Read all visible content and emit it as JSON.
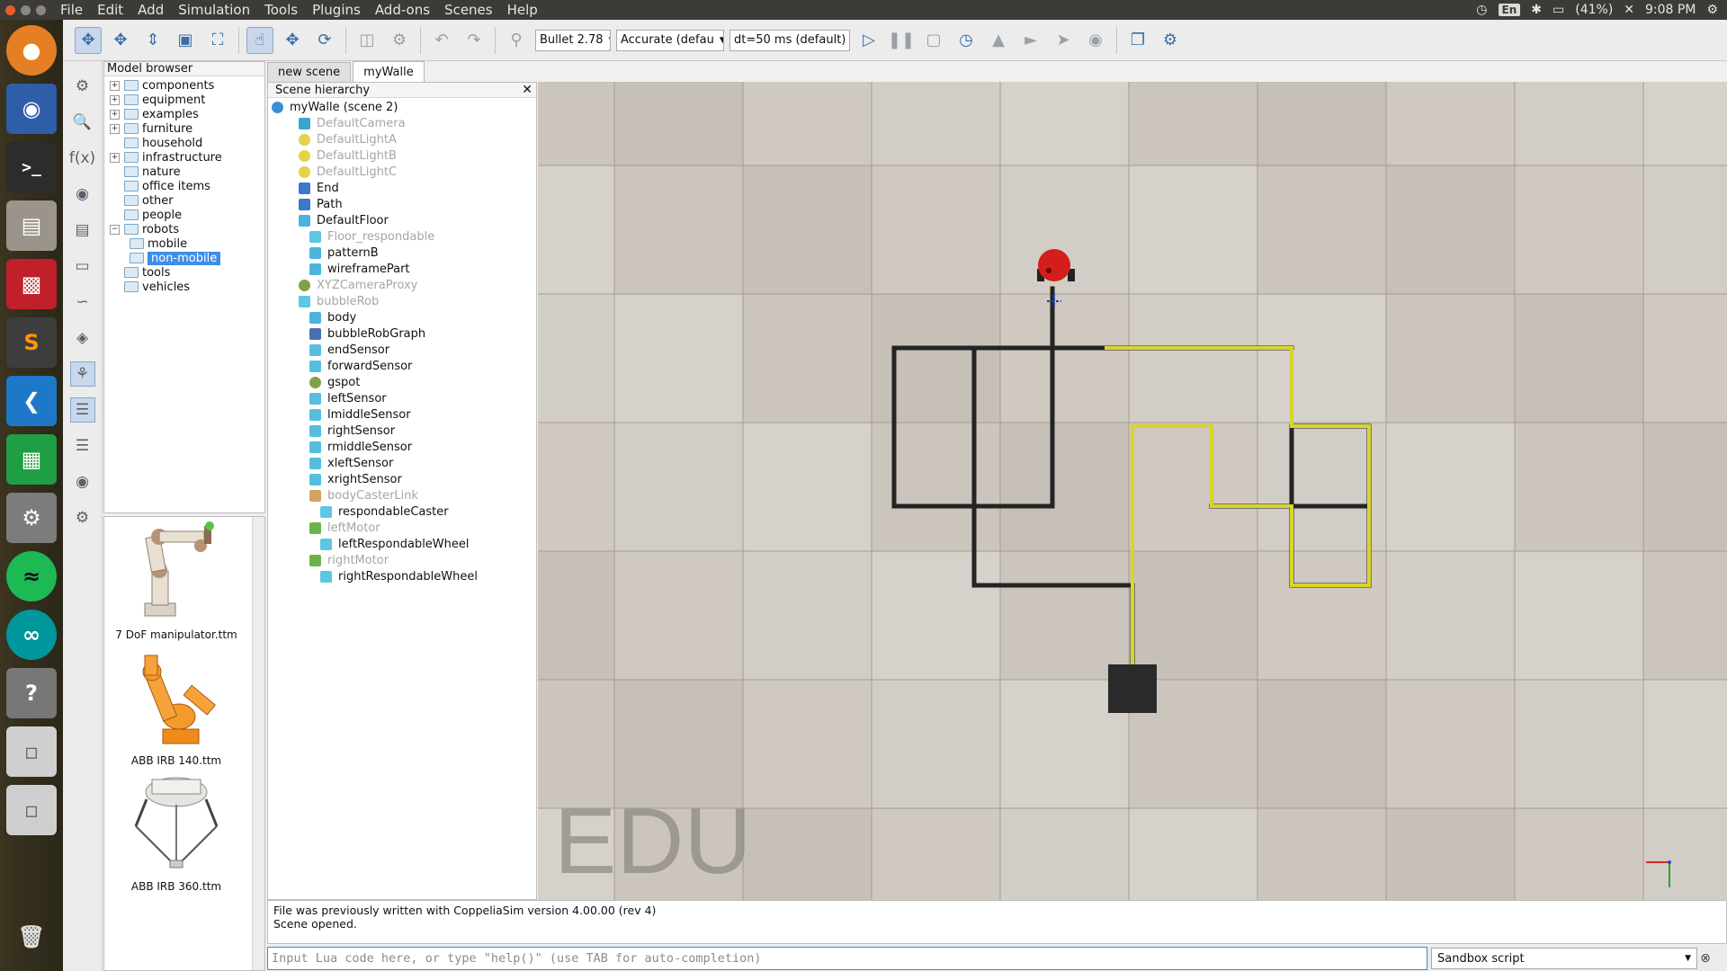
{
  "menubar": {
    "items": [
      "File",
      "Edit",
      "Add",
      "Simulation",
      "Tools",
      "Plugins",
      "Add-ons",
      "Scenes",
      "Help"
    ]
  },
  "system": {
    "language": "En",
    "battery": "(41%)",
    "time": "9:08 PM"
  },
  "toolbar": {
    "engine": "Bullet 2.78",
    "accuracy": "Accurate (defau",
    "timestep": "dt=50 ms (default)"
  },
  "model_browser": {
    "title": "Model browser",
    "items": [
      {
        "label": "components",
        "expandable": true
      },
      {
        "label": "equipment",
        "expandable": true
      },
      {
        "label": "examples",
        "expandable": true
      },
      {
        "label": "furniture",
        "expandable": true
      },
      {
        "label": "household",
        "expandable": false
      },
      {
        "label": "infrastructure",
        "expandable": true
      },
      {
        "label": "nature",
        "expandable": false
      },
      {
        "label": "office items",
        "expandable": false
      },
      {
        "label": "other",
        "expandable": false
      },
      {
        "label": "people",
        "expandable": false
      },
      {
        "label": "robots",
        "expandable": true,
        "expanded": true
      },
      {
        "label": "mobile",
        "child": true
      },
      {
        "label": "non-mobile",
        "child": true,
        "selected": true
      },
      {
        "label": "tools",
        "expandable": false
      },
      {
        "label": "vehicles",
        "expandable": false
      }
    ],
    "thumbnails": [
      "7 DoF manipulator.ttm",
      "ABB IRB 140.ttm",
      "ABB IRB 360.ttm"
    ]
  },
  "tabs": [
    "new scene",
    "myWalle"
  ],
  "scene_hierarchy": {
    "title": "Scene hierarchy",
    "rows": [
      {
        "label": "myWalle (scene 2)",
        "level": 0,
        "icon": "scene",
        "gray": false
      },
      {
        "label": "DefaultCamera",
        "level": 1,
        "icon": "camera",
        "gray": true
      },
      {
        "label": "DefaultLightA",
        "level": 1,
        "icon": "light",
        "gray": true
      },
      {
        "label": "DefaultLightB",
        "level": 1,
        "icon": "light",
        "gray": true
      },
      {
        "label": "DefaultLightC",
        "level": 1,
        "icon": "light",
        "gray": true
      },
      {
        "label": "End",
        "level": 1,
        "icon": "path",
        "gray": false
      },
      {
        "label": "Path",
        "level": 1,
        "icon": "path",
        "gray": false
      },
      {
        "label": "DefaultFloor",
        "level": 1,
        "icon": "shape",
        "gray": false
      },
      {
        "label": "Floor_respondable",
        "level": 2,
        "icon": "cuboid",
        "gray": true
      },
      {
        "label": "patternB",
        "level": 2,
        "icon": "shape",
        "gray": false
      },
      {
        "label": "wireframePart",
        "level": 2,
        "icon": "shape",
        "gray": false
      },
      {
        "label": "XYZCameraProxy",
        "level": 1,
        "icon": "proxy",
        "gray": true
      },
      {
        "label": "bubbleRob",
        "level": 1,
        "icon": "cuboid",
        "gray": true
      },
      {
        "label": "body",
        "level": 2,
        "icon": "shape",
        "gray": false
      },
      {
        "label": "bubbleRobGraph",
        "level": 2,
        "icon": "graph",
        "gray": false
      },
      {
        "label": "endSensor",
        "level": 2,
        "icon": "sensor",
        "gray": false
      },
      {
        "label": "forwardSensor",
        "level": 2,
        "icon": "sensor",
        "gray": false
      },
      {
        "label": "gspot",
        "level": 2,
        "icon": "proxy",
        "gray": false
      },
      {
        "label": "leftSensor",
        "level": 2,
        "icon": "sensor",
        "gray": false
      },
      {
        "label": "lmiddleSensor",
        "level": 2,
        "icon": "sensor",
        "gray": false
      },
      {
        "label": "rightSensor",
        "level": 2,
        "icon": "sensor",
        "gray": false
      },
      {
        "label": "rmiddleSensor",
        "level": 2,
        "icon": "sensor",
        "gray": false
      },
      {
        "label": "xleftSensor",
        "level": 2,
        "icon": "sensor",
        "gray": false
      },
      {
        "label": "xrightSensor",
        "level": 2,
        "icon": "sensor",
        "gray": false
      },
      {
        "label": "bodyCasterLink",
        "level": 2,
        "icon": "joint",
        "gray": true
      },
      {
        "label": "respondableCaster",
        "level": 3,
        "icon": "cuboid",
        "gray": false
      },
      {
        "label": "leftMotor",
        "level": 2,
        "icon": "motor",
        "gray": true
      },
      {
        "label": "leftRespondableWheel",
        "level": 3,
        "icon": "cuboid",
        "gray": false
      },
      {
        "label": "rightMotor",
        "level": 2,
        "icon": "motor",
        "gray": true
      },
      {
        "label": "rightRespondableWheel",
        "level": 3,
        "icon": "cuboid",
        "gray": false
      }
    ]
  },
  "viewport": {
    "watermark": "EDU"
  },
  "console": {
    "lines": [
      "File was previously written with CoppeliaSim version 4.00.00 (rev 4)",
      "Scene opened."
    ],
    "input_placeholder": "Input Lua code here, or type \"help()\" (use TAB for auto-completion)",
    "script_type": "Sandbox script"
  }
}
